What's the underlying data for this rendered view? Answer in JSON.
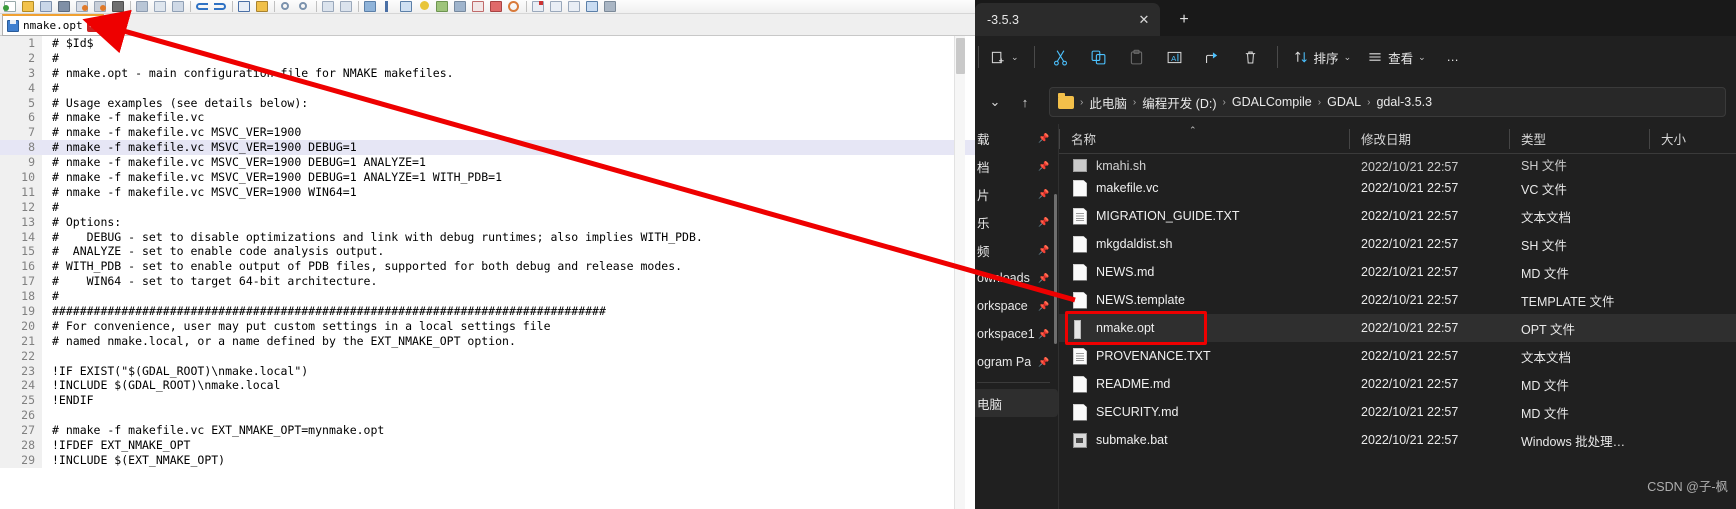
{
  "editor": {
    "tab": {
      "filename": "nmake.opt",
      "save_icon": "floppy-save-icon",
      "close_icon": "close-red-icon"
    },
    "toolbar_icons": [
      "new-file-icon",
      "open-folder-icon",
      "save-icon",
      "save-all-icon",
      "close-file-icon",
      "close-all-icon",
      "print-icon",
      "cut-icon",
      "copy-icon",
      "paste-icon",
      "undo-icon",
      "redo-icon",
      "find-icon",
      "replace-icon",
      "zoom-in-icon",
      "zoom-out-icon",
      "indent-icon",
      "outdent-icon",
      "wrap-icon",
      "pilcrow-icon",
      "indent-guide-icon",
      "bulb-icon",
      "map-icon",
      "clone-icon",
      "pencil-icon",
      "stop-icon",
      "record-icon",
      "macro1-icon",
      "macro2-icon",
      "macro3-icon",
      "macro4-icon",
      "plugin-icon"
    ],
    "highlight_line": 8,
    "lines": [
      {
        "n": 1,
        "text": "# $Id$"
      },
      {
        "n": 2,
        "text": "#"
      },
      {
        "n": 3,
        "text": "# nmake.opt - main configuration file for NMAKE makefiles."
      },
      {
        "n": 4,
        "text": "#"
      },
      {
        "n": 5,
        "text": "# Usage examples (see details below):"
      },
      {
        "n": 6,
        "text": "# nmake -f makefile.vc"
      },
      {
        "n": 7,
        "text": "# nmake -f makefile.vc MSVC_VER=1900"
      },
      {
        "n": 8,
        "text": "# nmake -f makefile.vc MSVC_VER=1900 DEBUG=1"
      },
      {
        "n": 9,
        "text": "# nmake -f makefile.vc MSVC_VER=1900 DEBUG=1 ANALYZE=1"
      },
      {
        "n": 10,
        "text": "# nmake -f makefile.vc MSVC_VER=1900 DEBUG=1 ANALYZE=1 WITH_PDB=1"
      },
      {
        "n": 11,
        "text": "# nmake -f makefile.vc MSVC_VER=1900 WIN64=1"
      },
      {
        "n": 12,
        "text": "#"
      },
      {
        "n": 13,
        "text": "# Options:"
      },
      {
        "n": 14,
        "text": "#    DEBUG - set to disable optimizations and link with debug runtimes; also implies WITH_PDB."
      },
      {
        "n": 15,
        "text": "#  ANALYZE - set to enable code analysis output."
      },
      {
        "n": 16,
        "text": "# WITH_PDB - set to enable output of PDB files, supported for both debug and release modes."
      },
      {
        "n": 17,
        "text": "#    WIN64 - set to target 64-bit architecture."
      },
      {
        "n": 18,
        "text": "#"
      },
      {
        "n": 19,
        "text": "################################################################################"
      },
      {
        "n": 20,
        "text": "# For convenience, user may put custom settings in a local settings file"
      },
      {
        "n": 21,
        "text": "# named nmake.local, or a name defined by the EXT_NMAKE_OPT option."
      },
      {
        "n": 22,
        "text": ""
      },
      {
        "n": 23,
        "text": "!IF EXIST(\"$(GDAL_ROOT)\\nmake.local\")"
      },
      {
        "n": 24,
        "text": "!INCLUDE $(GDAL_ROOT)\\nmake.local"
      },
      {
        "n": 25,
        "text": "!ENDIF"
      },
      {
        "n": 26,
        "text": ""
      },
      {
        "n": 27,
        "text": "# nmake -f makefile.vc EXT_NMAKE_OPT=mynmake.opt"
      },
      {
        "n": 28,
        "text": "!IFDEF EXT_NMAKE_OPT"
      },
      {
        "n": 29,
        "text": "!INCLUDE $(EXT_NMAKE_OPT)"
      }
    ]
  },
  "explorer": {
    "tab": {
      "title": "-3.5.3",
      "close_label": "✕",
      "new_tab_label": "+"
    },
    "toolbar": {
      "new_label": "",
      "new_chevron": "⌄",
      "cut_label": "",
      "copy_label": "",
      "paste_label": "",
      "rename_label": "",
      "share_label": "",
      "delete_label": "",
      "sort_label": "排序",
      "sort_chevron": "⌄",
      "view_label": "查看",
      "view_chevron": "⌄",
      "more_label": "…"
    },
    "address": {
      "down_chevron": "⌄",
      "up_arrow": "↑",
      "crumbs": [
        "此电脑",
        "编程开发 (D:)",
        "GDALCompile",
        "GDAL",
        "gdal-3.5.3"
      ],
      "separator": "›"
    },
    "nav_items": [
      {
        "label": "载",
        "pinned": true
      },
      {
        "label": "档",
        "pinned": true
      },
      {
        "label": "片",
        "pinned": true
      },
      {
        "label": "乐",
        "pinned": true
      },
      {
        "label": "频",
        "pinned": true
      },
      {
        "label": "ownloads",
        "pinned": true
      },
      {
        "label": "orkspace",
        "pinned": true
      },
      {
        "label": "orkspace1",
        "pinned": true
      },
      {
        "label": "ogram Pa",
        "pinned": true
      }
    ],
    "nav_selected": {
      "label": "电脑"
    },
    "columns": [
      "名称",
      "修改日期",
      "类型",
      "大小"
    ],
    "sort_caret": "⌃",
    "rows": [
      {
        "name": "kmahi.sh",
        "date": "2022/10/21 22:57",
        "type": "SH 文件",
        "size": "",
        "icon": "sh-file-icon",
        "selected": false,
        "clipped": true
      },
      {
        "name": "makefile.vc",
        "date": "2022/10/21 22:57",
        "type": "VC 文件",
        "size": "",
        "icon": "doc-file-icon",
        "selected": false
      },
      {
        "name": "MIGRATION_GUIDE.TXT",
        "date": "2022/10/21 22:57",
        "type": "文本文档",
        "size": "",
        "icon": "txt-file-icon",
        "selected": false
      },
      {
        "name": "mkgdaldist.sh",
        "date": "2022/10/21 22:57",
        "type": "SH 文件",
        "size": "",
        "icon": "doc-file-icon",
        "selected": false
      },
      {
        "name": "NEWS.md",
        "date": "2022/10/21 22:57",
        "type": "MD 文件",
        "size": "",
        "icon": "doc-file-icon",
        "selected": false
      },
      {
        "name": "NEWS.template",
        "date": "2022/10/21 22:57",
        "type": "TEMPLATE 文件",
        "size": "",
        "icon": "doc-file-icon",
        "selected": false
      },
      {
        "name": "nmake.opt",
        "date": "2022/10/21 22:57",
        "type": "OPT 文件",
        "size": "",
        "icon": "opt-file-icon",
        "selected": true
      },
      {
        "name": "PROVENANCE.TXT",
        "date": "2022/10/21 22:57",
        "type": "文本文档",
        "size": "",
        "icon": "txt-file-icon",
        "selected": false
      },
      {
        "name": "README.md",
        "date": "2022/10/21 22:57",
        "type": "MD 文件",
        "size": "",
        "icon": "doc-file-icon",
        "selected": false
      },
      {
        "name": "SECURITY.md",
        "date": "2022/10/21 22:57",
        "type": "MD 文件",
        "size": "",
        "icon": "doc-file-icon",
        "selected": false
      },
      {
        "name": "submake.bat",
        "date": "2022/10/21 22:57",
        "type": "Windows 批处理…",
        "size": "",
        "icon": "bat-file-icon",
        "selected": false
      }
    ]
  },
  "annotations": {
    "highlight_color": "#ee0000",
    "arrow_note": "two red arrows point from the explorer file entry to the editor tab",
    "watermark": "CSDN @子-枫"
  }
}
